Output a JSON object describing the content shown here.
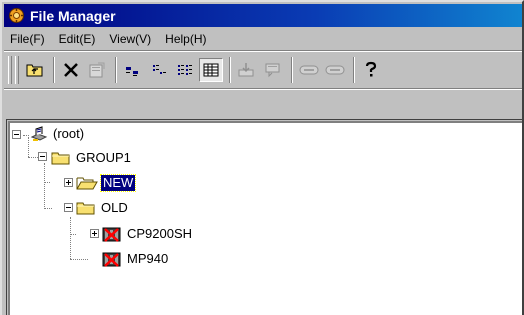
{
  "window": {
    "title": "File Manager",
    "accent": "#000080"
  },
  "menu": {
    "file": "File(F)",
    "edit": "Edit(E)",
    "view": "View(V)",
    "help": "Help(H)"
  },
  "toolbar": {
    "icons": [
      "up-folder-icon",
      "delete-icon",
      "properties-icon",
      "large-icons-icon",
      "small-icons-icon",
      "list-view-icon",
      "details-view-icon",
      "download-icon",
      "upload-icon",
      "connect-icon",
      "disconnect-icon",
      "help-icon"
    ]
  },
  "tree": {
    "root_label": "(root)",
    "group1_label": "GROUP1",
    "new_label": "NEW",
    "old_label": "OLD",
    "cp_label": "CP9200SH",
    "mp_label": "MP940"
  }
}
